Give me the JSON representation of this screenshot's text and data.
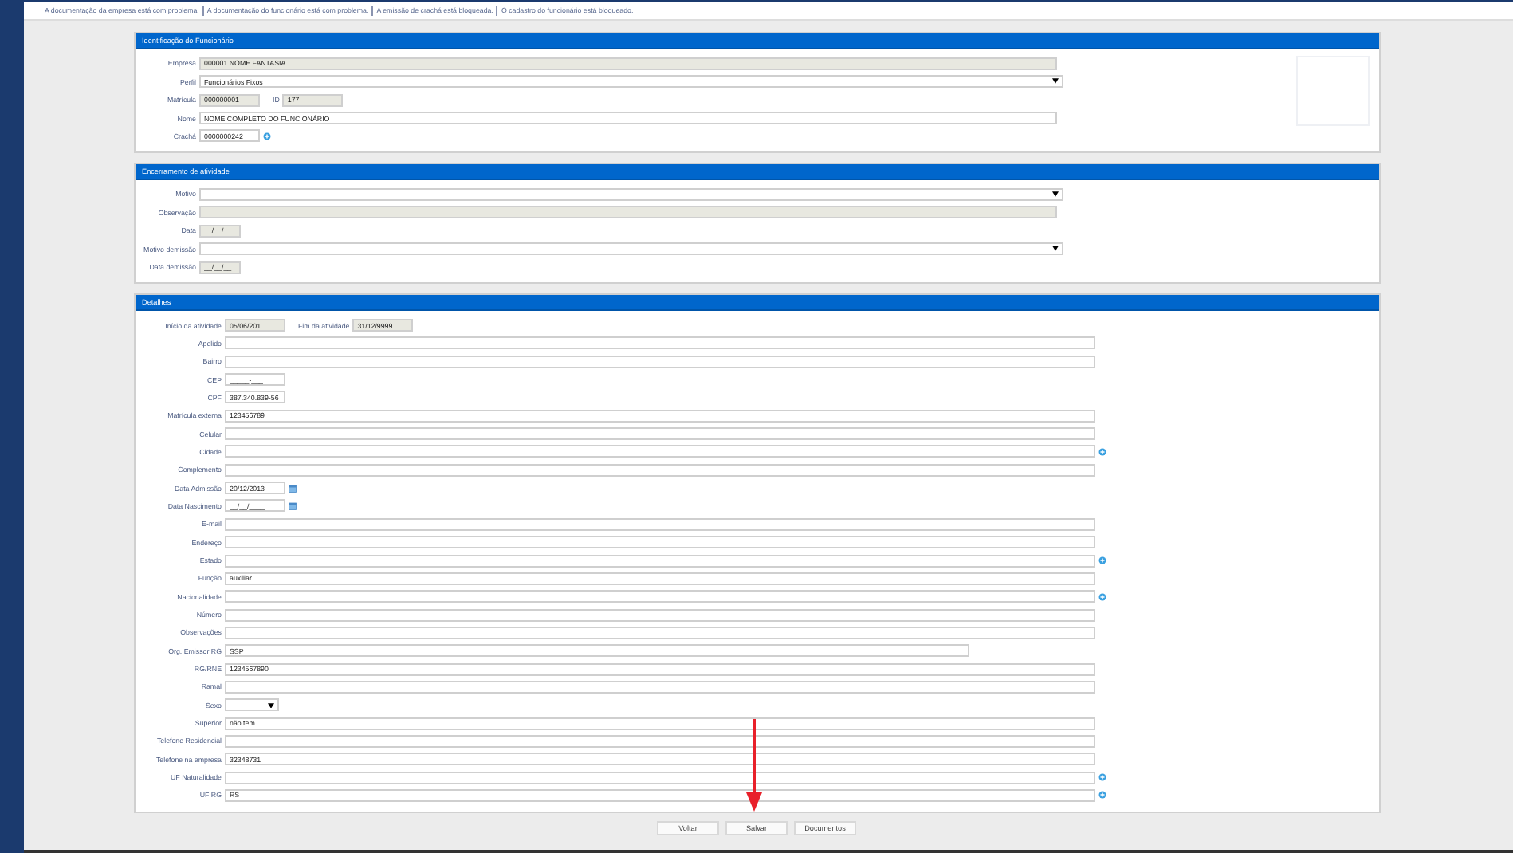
{
  "warnings": [
    "A documentação da empresa está com problema.",
    "A documentação do funcionário está com problema.",
    "A emissão de crachá está bloqueada.",
    "O cadastro do funcionário está bloqueado."
  ],
  "panels": [
    {
      "title": "Identificação do Funcionário",
      "rows": [
        {
          "label": "Empresa",
          "value": "000001 NOME FANTASIA",
          "kind": "readonly"
        },
        {
          "label": "Perfil",
          "value": "Funcionários Fixos",
          "kind": "select"
        },
        {
          "kind": "pair",
          "fields": [
            {
              "label": "Matrícula",
              "value": "000000001",
              "kind": "readonly-short"
            },
            {
              "label": "ID",
              "value": "177",
              "kind": "readonly-short"
            }
          ]
        },
        {
          "label": "Nome",
          "value": "NOME COMPLETO DO FUNCIONÁRIO",
          "kind": "text"
        },
        {
          "label": "Crachá",
          "value": "0000000242",
          "kind": "short-lookup"
        }
      ]
    },
    {
      "title": "Encerramento de atividade",
      "rows": [
        {
          "label": "Motivo",
          "value": "",
          "kind": "select"
        },
        {
          "label": "Observação",
          "value": "",
          "kind": "readonly"
        },
        {
          "label": "Data",
          "value": "__/__/__",
          "kind": "readonly-date"
        },
        {
          "label": "Motivo demissão",
          "value": "",
          "kind": "select"
        },
        {
          "label": "Data demissão",
          "value": "__/__/__",
          "kind": "readonly-date"
        }
      ]
    },
    {
      "title": "Detalhes",
      "rows": [
        {
          "kind": "pair",
          "fields": [
            {
              "label": "Início da atividade",
              "value": "05/06/201",
              "kind": "readonly-short"
            },
            {
              "label": "Fim da atividade",
              "value": "31/12/9999",
              "kind": "readonly-short"
            }
          ]
        },
        {
          "label": "Apelido",
          "value": "",
          "kind": "text"
        },
        {
          "label": "Bairro",
          "value": "",
          "kind": "text"
        },
        {
          "label": "CEP",
          "value": "_____-___",
          "kind": "short"
        },
        {
          "label": "CPF",
          "value": "387.340.839-56",
          "kind": "short"
        },
        {
          "label": "Matrícula externa",
          "value": "123456789",
          "kind": "text"
        },
        {
          "label": "Celular",
          "value": "",
          "kind": "text"
        },
        {
          "label": "Cidade",
          "value": "",
          "kind": "lookup"
        },
        {
          "label": "Complemento",
          "value": "",
          "kind": "text"
        },
        {
          "label": "Data Admissão",
          "value": "20/12/2013",
          "kind": "date"
        },
        {
          "label": "Data Nascimento",
          "value": "__/__/____",
          "kind": "date"
        },
        {
          "label": "E-mail",
          "value": "",
          "kind": "text"
        },
        {
          "label": "Endereço",
          "value": "",
          "kind": "text"
        },
        {
          "label": "Estado",
          "value": "",
          "kind": "lookup"
        },
        {
          "label": "Função",
          "value": "auxiliar",
          "kind": "text"
        },
        {
          "label": "Nacionalidade",
          "value": "",
          "kind": "lookup"
        },
        {
          "label": "Número",
          "value": "",
          "kind": "text"
        },
        {
          "label": "Observações",
          "value": "",
          "kind": "text"
        },
        {
          "label": "Org. Emissor RG",
          "value": "SSP",
          "kind": "medium"
        },
        {
          "label": "RG/RNE",
          "value": "1234567890",
          "kind": "text"
        },
        {
          "label": "Ramal",
          "value": "",
          "kind": "text"
        },
        {
          "label": "Sexo",
          "value": "",
          "kind": "select-short"
        },
        {
          "label": "Superior",
          "value": "não tem",
          "kind": "text"
        },
        {
          "label": "Telefone Residencial",
          "value": "",
          "kind": "text"
        },
        {
          "label": "Telefone na empresa",
          "value": "32348731",
          "kind": "text"
        },
        {
          "label": "UF Naturalidade",
          "value": "",
          "kind": "lookup"
        },
        {
          "label": "UF RG",
          "value": "RS",
          "kind": "lookup"
        }
      ]
    }
  ],
  "buttons": [
    "Voltar",
    "Salvar",
    "Documentos"
  ],
  "annotation": {
    "kind": "arrow"
  }
}
